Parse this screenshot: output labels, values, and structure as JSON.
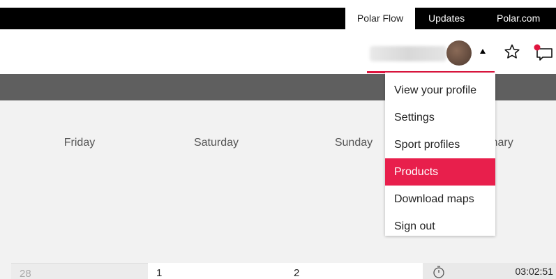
{
  "topnav": {
    "items": [
      {
        "label": "Polar Flow"
      },
      {
        "label": "Updates"
      },
      {
        "label": "Polar.com"
      }
    ]
  },
  "user": {
    "name_blurred": "",
    "icons": [
      "caret-up-icon",
      "star-icon",
      "notification-icon"
    ]
  },
  "dropdown": {
    "items": [
      {
        "label": "View your profile"
      },
      {
        "label": "Settings"
      },
      {
        "label": "Sport profiles"
      },
      {
        "label": "Products",
        "active": true
      },
      {
        "label": "Download maps"
      },
      {
        "label": "Sign out"
      }
    ]
  },
  "calendar": {
    "days": [
      {
        "label": "Friday"
      },
      {
        "label": "Saturday"
      },
      {
        "label": "Sunday"
      },
      {
        "label": "Summary"
      }
    ],
    "dates": [
      {
        "label": "28"
      },
      {
        "label": "1"
      },
      {
        "label": "2"
      }
    ],
    "summary_time": "03:02:51"
  },
  "colors": {
    "accent": "#e81f4c",
    "nav_bg": "#000000",
    "band": "#5f5f5f",
    "calendar_bg": "#f2f2f2"
  }
}
